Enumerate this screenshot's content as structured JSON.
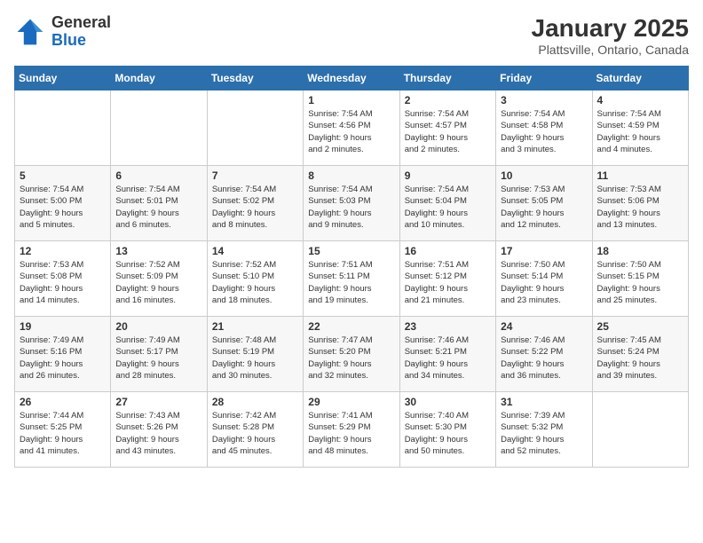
{
  "logo": {
    "line1": "General",
    "line2": "Blue"
  },
  "title": "January 2025",
  "subtitle": "Plattsville, Ontario, Canada",
  "weekdays": [
    "Sunday",
    "Monday",
    "Tuesday",
    "Wednesday",
    "Thursday",
    "Friday",
    "Saturday"
  ],
  "weeks": [
    [
      {
        "day": "",
        "info": ""
      },
      {
        "day": "",
        "info": ""
      },
      {
        "day": "",
        "info": ""
      },
      {
        "day": "1",
        "info": "Sunrise: 7:54 AM\nSunset: 4:56 PM\nDaylight: 9 hours\nand 2 minutes."
      },
      {
        "day": "2",
        "info": "Sunrise: 7:54 AM\nSunset: 4:57 PM\nDaylight: 9 hours\nand 2 minutes."
      },
      {
        "day": "3",
        "info": "Sunrise: 7:54 AM\nSunset: 4:58 PM\nDaylight: 9 hours\nand 3 minutes."
      },
      {
        "day": "4",
        "info": "Sunrise: 7:54 AM\nSunset: 4:59 PM\nDaylight: 9 hours\nand 4 minutes."
      }
    ],
    [
      {
        "day": "5",
        "info": "Sunrise: 7:54 AM\nSunset: 5:00 PM\nDaylight: 9 hours\nand 5 minutes."
      },
      {
        "day": "6",
        "info": "Sunrise: 7:54 AM\nSunset: 5:01 PM\nDaylight: 9 hours\nand 6 minutes."
      },
      {
        "day": "7",
        "info": "Sunrise: 7:54 AM\nSunset: 5:02 PM\nDaylight: 9 hours\nand 8 minutes."
      },
      {
        "day": "8",
        "info": "Sunrise: 7:54 AM\nSunset: 5:03 PM\nDaylight: 9 hours\nand 9 minutes."
      },
      {
        "day": "9",
        "info": "Sunrise: 7:54 AM\nSunset: 5:04 PM\nDaylight: 9 hours\nand 10 minutes."
      },
      {
        "day": "10",
        "info": "Sunrise: 7:53 AM\nSunset: 5:05 PM\nDaylight: 9 hours\nand 12 minutes."
      },
      {
        "day": "11",
        "info": "Sunrise: 7:53 AM\nSunset: 5:06 PM\nDaylight: 9 hours\nand 13 minutes."
      }
    ],
    [
      {
        "day": "12",
        "info": "Sunrise: 7:53 AM\nSunset: 5:08 PM\nDaylight: 9 hours\nand 14 minutes."
      },
      {
        "day": "13",
        "info": "Sunrise: 7:52 AM\nSunset: 5:09 PM\nDaylight: 9 hours\nand 16 minutes."
      },
      {
        "day": "14",
        "info": "Sunrise: 7:52 AM\nSunset: 5:10 PM\nDaylight: 9 hours\nand 18 minutes."
      },
      {
        "day": "15",
        "info": "Sunrise: 7:51 AM\nSunset: 5:11 PM\nDaylight: 9 hours\nand 19 minutes."
      },
      {
        "day": "16",
        "info": "Sunrise: 7:51 AM\nSunset: 5:12 PM\nDaylight: 9 hours\nand 21 minutes."
      },
      {
        "day": "17",
        "info": "Sunrise: 7:50 AM\nSunset: 5:14 PM\nDaylight: 9 hours\nand 23 minutes."
      },
      {
        "day": "18",
        "info": "Sunrise: 7:50 AM\nSunset: 5:15 PM\nDaylight: 9 hours\nand 25 minutes."
      }
    ],
    [
      {
        "day": "19",
        "info": "Sunrise: 7:49 AM\nSunset: 5:16 PM\nDaylight: 9 hours\nand 26 minutes."
      },
      {
        "day": "20",
        "info": "Sunrise: 7:49 AM\nSunset: 5:17 PM\nDaylight: 9 hours\nand 28 minutes."
      },
      {
        "day": "21",
        "info": "Sunrise: 7:48 AM\nSunset: 5:19 PM\nDaylight: 9 hours\nand 30 minutes."
      },
      {
        "day": "22",
        "info": "Sunrise: 7:47 AM\nSunset: 5:20 PM\nDaylight: 9 hours\nand 32 minutes."
      },
      {
        "day": "23",
        "info": "Sunrise: 7:46 AM\nSunset: 5:21 PM\nDaylight: 9 hours\nand 34 minutes."
      },
      {
        "day": "24",
        "info": "Sunrise: 7:46 AM\nSunset: 5:22 PM\nDaylight: 9 hours\nand 36 minutes."
      },
      {
        "day": "25",
        "info": "Sunrise: 7:45 AM\nSunset: 5:24 PM\nDaylight: 9 hours\nand 39 minutes."
      }
    ],
    [
      {
        "day": "26",
        "info": "Sunrise: 7:44 AM\nSunset: 5:25 PM\nDaylight: 9 hours\nand 41 minutes."
      },
      {
        "day": "27",
        "info": "Sunrise: 7:43 AM\nSunset: 5:26 PM\nDaylight: 9 hours\nand 43 minutes."
      },
      {
        "day": "28",
        "info": "Sunrise: 7:42 AM\nSunset: 5:28 PM\nDaylight: 9 hours\nand 45 minutes."
      },
      {
        "day": "29",
        "info": "Sunrise: 7:41 AM\nSunset: 5:29 PM\nDaylight: 9 hours\nand 48 minutes."
      },
      {
        "day": "30",
        "info": "Sunrise: 7:40 AM\nSunset: 5:30 PM\nDaylight: 9 hours\nand 50 minutes."
      },
      {
        "day": "31",
        "info": "Sunrise: 7:39 AM\nSunset: 5:32 PM\nDaylight: 9 hours\nand 52 minutes."
      },
      {
        "day": "",
        "info": ""
      }
    ]
  ]
}
